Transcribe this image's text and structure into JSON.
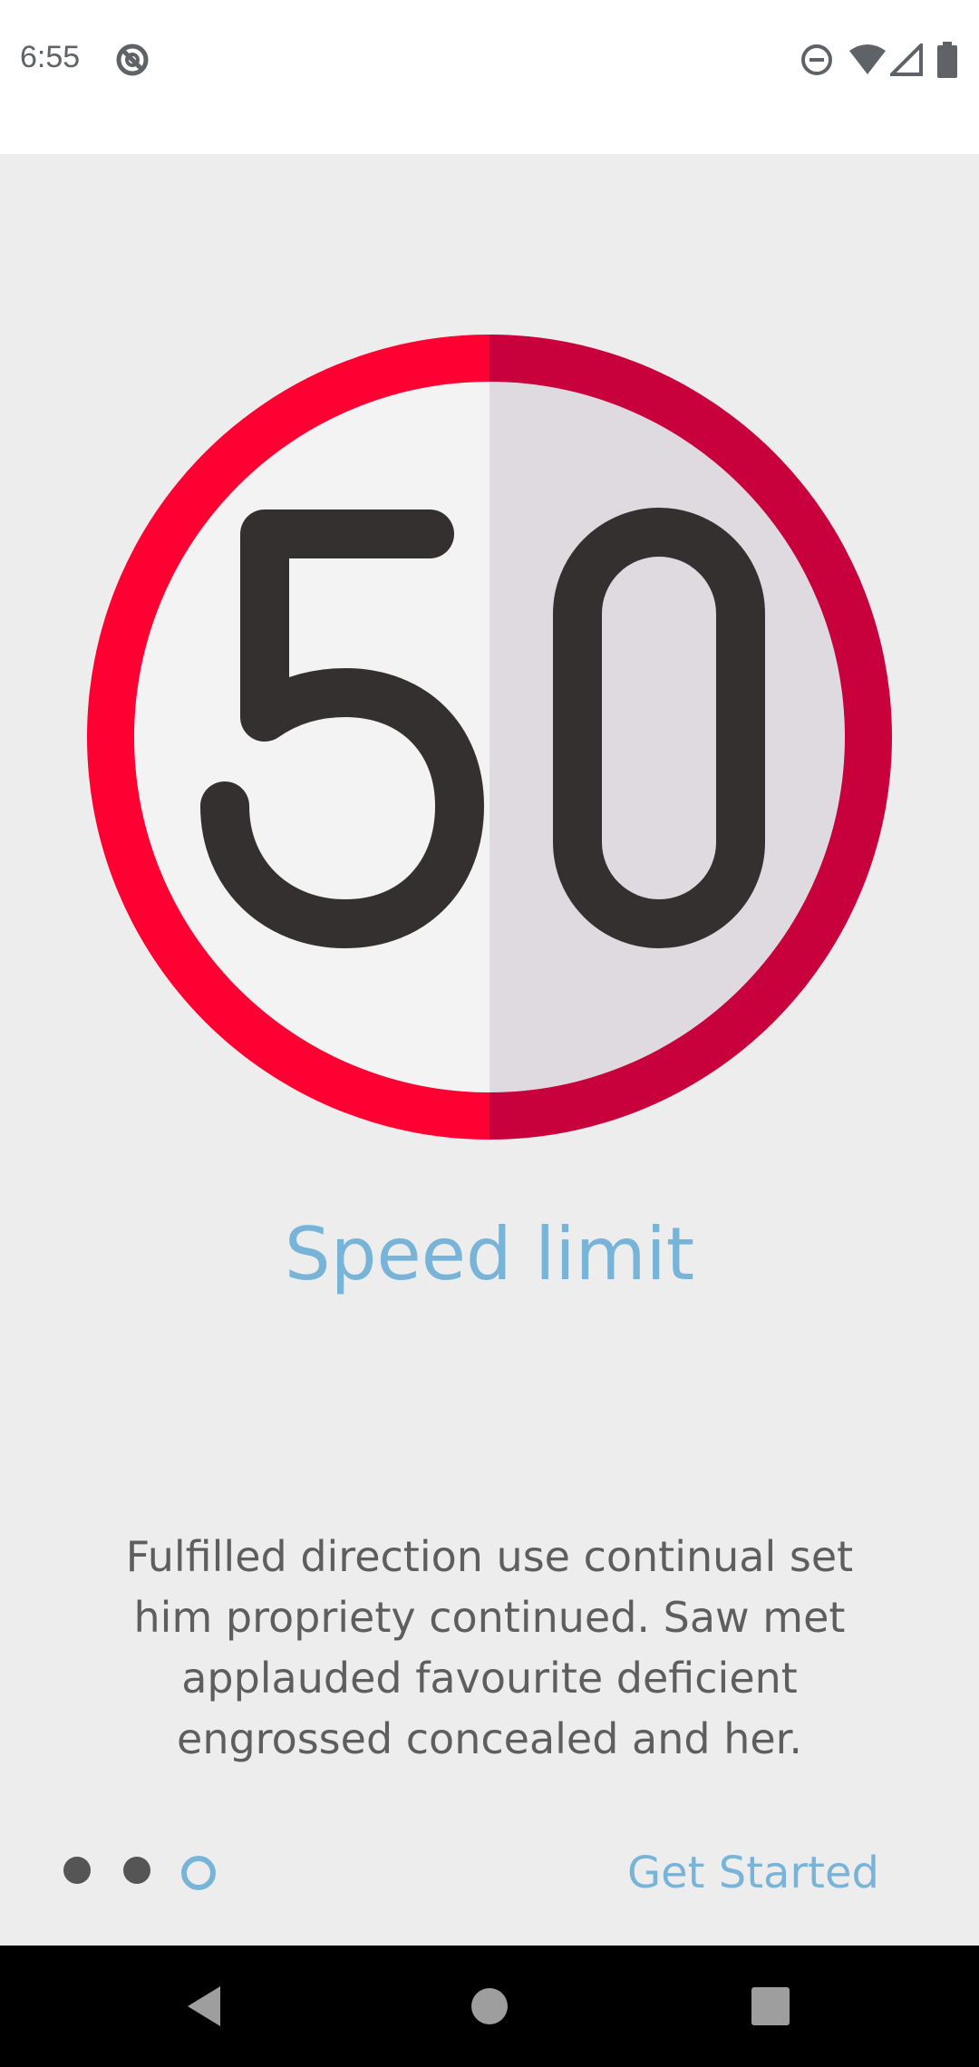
{
  "status_bar": {
    "time": "6:55",
    "icons": [
      "sync-disabled-icon",
      "do-not-disturb-icon",
      "wifi-icon",
      "signal-icon",
      "battery-icon"
    ]
  },
  "onboarding": {
    "sign_number": "50",
    "title": "Speed limit",
    "description": "Fulfilled direction use continual set him propriety continued. Saw met applauded favourite deficient engrossed concealed and her.",
    "page_indicator": {
      "total": 3,
      "current": 3
    },
    "get_started_label": "Get Started"
  },
  "colors": {
    "accent": "#78b3d8",
    "ring_left": "#ff0033",
    "ring_right": "#c8003b",
    "face_left": "#f4f3f4",
    "face_right": "#dedadf",
    "digits": "#353030"
  },
  "nav_bar": {
    "buttons": [
      "back-icon",
      "home-icon",
      "recents-icon"
    ]
  }
}
